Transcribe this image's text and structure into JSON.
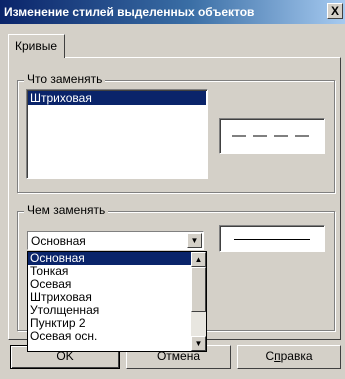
{
  "window": {
    "title": "Изменение стилей выделенных объектов",
    "close_glyph": "X"
  },
  "tabs": [
    {
      "label": "Кривые",
      "active": true
    }
  ],
  "what_group": {
    "label": "Что заменять",
    "list_items": [
      "Штриховая"
    ],
    "selected_item": "Штриховая",
    "preview_style": "dashed"
  },
  "with_group": {
    "label": "Чем заменять",
    "combo_value": "Основная",
    "preview_style": "solid",
    "dropdown_options": [
      "Основная",
      "Тонкая",
      "Осевая",
      "Штриховая",
      "Утолщенная",
      "Пунктир 2",
      "Осевая осн."
    ],
    "dropdown_selected": "Основная",
    "scroll_up_glyph": "▲",
    "scroll_down_glyph": "▼"
  },
  "buttons": {
    "ok": "OK",
    "cancel": "Отмена",
    "help_prefix": "С",
    "help_underlined": "п",
    "help_suffix": "равка"
  },
  "colors": {
    "face": "#d4d0c8",
    "title_start": "#0a246a",
    "selection": "#0a246a"
  }
}
